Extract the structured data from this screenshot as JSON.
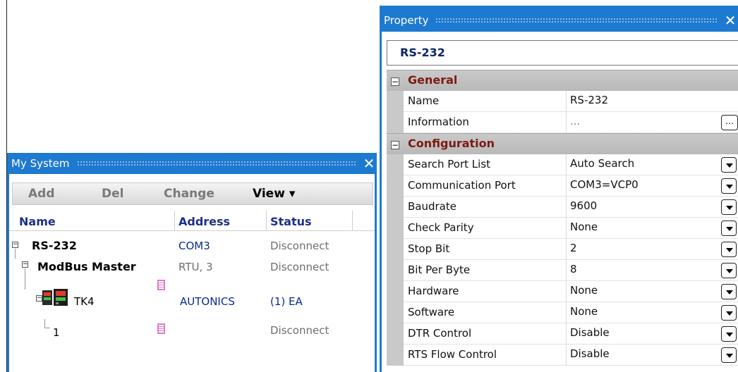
{
  "my_system": {
    "title": "My System",
    "toolbar": {
      "add": "Add",
      "del": "Del",
      "change": "Change",
      "view": "View ▾"
    },
    "columns": {
      "name": "Name",
      "address": "Address",
      "status": "Status"
    },
    "rows": [
      {
        "name": "RS-232",
        "address": "COM3",
        "status": "Disconnect"
      },
      {
        "name": "ModBus Master",
        "address": "RTU, 3",
        "status": "Disconnect"
      },
      {
        "name": "TK4",
        "address": "AUTONICS",
        "status": "(1) EA"
      },
      {
        "name": "1",
        "address": "",
        "status": "Disconnect"
      }
    ]
  },
  "property": {
    "title": "Property",
    "header": "RS-232",
    "categories": [
      {
        "label": "General",
        "items": [
          {
            "name": "Name",
            "value": "RS-232"
          },
          {
            "name": "Information",
            "value": "..."
          }
        ]
      },
      {
        "label": "Configuration",
        "items": [
          {
            "name": "Search Port List",
            "value": "Auto Search"
          },
          {
            "name": "Communication Port",
            "value": "COM3=VCP0"
          },
          {
            "name": "Baudrate",
            "value": "9600"
          },
          {
            "name": "Check Parity",
            "value": "None"
          },
          {
            "name": "Stop Bit",
            "value": "2"
          },
          {
            "name": "Bit Per Byte",
            "value": "8"
          },
          {
            "name": "Hardware",
            "value": "None"
          },
          {
            "name": "Software",
            "value": "None"
          },
          {
            "name": "DTR Control",
            "value": "Disable"
          },
          {
            "name": "RTS Flow Control",
            "value": "Disable"
          }
        ]
      }
    ]
  },
  "icons": {
    "close": "close-icon",
    "collapse": "collapse-icon",
    "device": "device-icon",
    "doc": "document-icon",
    "dropdown": "chevron-down-icon",
    "ellipsis": "ellipsis-button"
  },
  "colors": {
    "titlebar": "#1e7ad0",
    "category_text": "#7c1a12",
    "header_text": "#1c2f8a",
    "doc_icon": "#e37ac8"
  }
}
